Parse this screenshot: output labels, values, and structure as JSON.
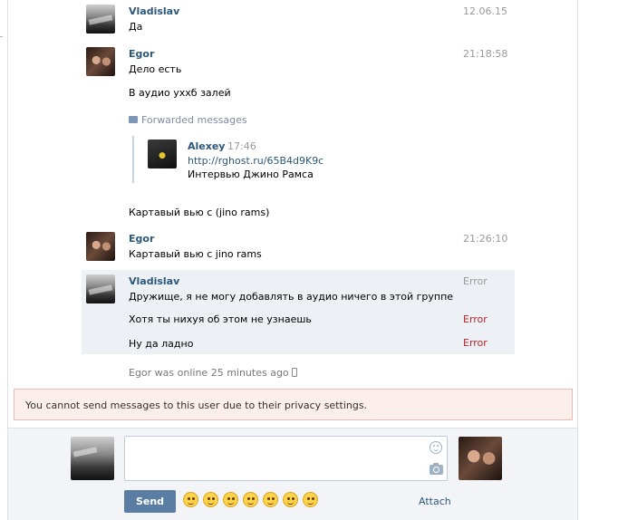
{
  "messages": [
    {
      "author": "Vladislav",
      "time": "12.06.15",
      "lines": [
        "Да"
      ]
    },
    {
      "author": "Egor",
      "time": "21:18:58",
      "lines": [
        "Дело есть",
        "В аудио ухxб залей"
      ],
      "forwarded_label": "Forwarded messages",
      "forwarded": {
        "author": "Alexey",
        "time": "17:46",
        "link": "http://rghost.ru/65B4d9K9c",
        "text": "Интервью Джино Рамса"
      },
      "after": "Картавый вью с (jino rams)"
    },
    {
      "author": "Egor",
      "time": "21:26:10",
      "lines": [
        "Картавый вью с jino rams"
      ]
    },
    {
      "author": "Vladislav",
      "status_first": "Error",
      "failed": [
        {
          "text": "Дружище, я не могу добавлять в аудио ничего в этой группе",
          "status": "Error"
        },
        {
          "text": "Хотя ты нихуя об этом не узнаешь",
          "status": "Error"
        },
        {
          "text": "Ну да ладно",
          "status": "Error"
        }
      ]
    }
  ],
  "online_status": "Egor was online 25 minutes ago",
  "privacy_notice": "You cannot send messages to this user due to their privacy settings.",
  "composer": {
    "placeholder": "",
    "send_label": "Send",
    "attach_label": "Attach"
  },
  "emojis": [
    "see-no-evil-monkey",
    "flushed-face",
    "grinning-sweat-face",
    "relieved-face",
    "grinning-face",
    "winking-tongue-face",
    "smiling-face"
  ],
  "colors": {
    "author": "#2b587a",
    "error": "#b8262b",
    "send_button": "#597da3",
    "error_bg": "#edf1f5",
    "privacy_bg": "#fbeeeb"
  }
}
